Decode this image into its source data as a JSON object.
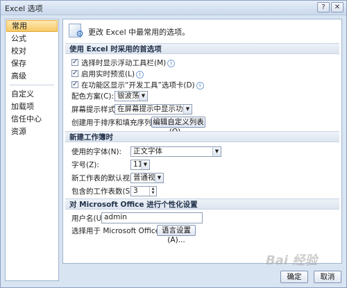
{
  "window": {
    "title": "Excel 选项"
  },
  "sidebar": {
    "items": [
      {
        "label": "常用"
      },
      {
        "label": "公式"
      },
      {
        "label": "校对"
      },
      {
        "label": "保存"
      },
      {
        "label": "高级"
      },
      {
        "label": "自定义"
      },
      {
        "label": "加载项"
      },
      {
        "label": "信任中心"
      },
      {
        "label": "资源"
      }
    ]
  },
  "header": {
    "text": "更改 Excel 中最常用的选项。"
  },
  "section1": {
    "title": "使用 Excel 时采用的首选项",
    "cb1": "选择时显示浮动工具栏(M)",
    "cb2": "启用实时预览(L)",
    "cb3": "在功能区显示“开发工具”选项卡(D)",
    "color_label": "配色方案(C):",
    "color_value": "银波荡漾",
    "tip_label": "屏幕提示样式(R):",
    "tip_value": "在屏幕提示中显示功能说明",
    "list_label": "创建用于排序和填充序列的列表:",
    "list_button": "编辑自定义列表(O)..."
  },
  "section2": {
    "title": "新建工作簿时",
    "font_label": "使用的字体(N):",
    "font_value": "正文字体",
    "size_label": "字号(Z):",
    "size_value": "11",
    "view_label": "新工作表的默认视图(V):",
    "view_value": "普通视图",
    "sheets_label": "包含的工作表数(S):",
    "sheets_value": "3"
  },
  "section3": {
    "title": "对 Microsoft Office 进行个性化设置",
    "user_label": "用户名(U):",
    "user_value": "admin",
    "lang_label": "选择用于 Microsoft Office 的语言:",
    "lang_button": "语言设置(A)..."
  },
  "footer": {
    "ok": "确定",
    "cancel": "取消"
  },
  "watermark": "Bai 经验"
}
